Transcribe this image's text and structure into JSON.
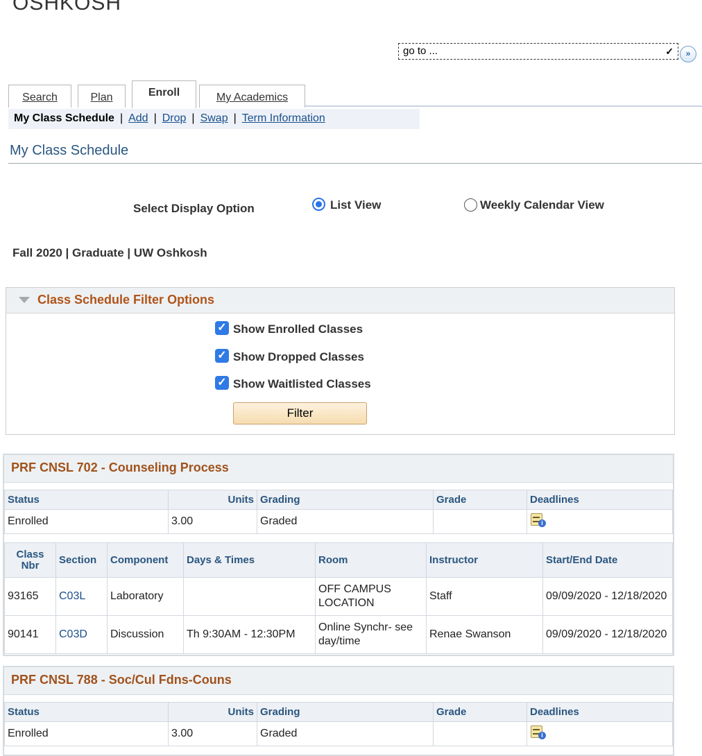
{
  "brand": {
    "logo_text": "OSHKOSH"
  },
  "goto": {
    "value": "go to ..."
  },
  "tabs": [
    {
      "label": "Search"
    },
    {
      "label": "Plan"
    },
    {
      "label": "Enroll"
    },
    {
      "label": "My Academics"
    }
  ],
  "subnav": {
    "current": "My Class Schedule",
    "links": [
      "Add",
      "Drop",
      "Swap",
      "Term Information"
    ]
  },
  "page_title": "My Class Schedule",
  "display_option": {
    "label": "Select Display Option",
    "list_view": "List View",
    "weekly_view": "Weekly Calendar View",
    "selected": "List View"
  },
  "term_info": "Fall 2020 | Graduate | UW Oshkosh",
  "filter": {
    "title": "Class Schedule Filter Options",
    "options": [
      {
        "label": "Show Enrolled Classes",
        "checked": true
      },
      {
        "label": "Show Dropped Classes",
        "checked": true
      },
      {
        "label": "Show Waitlisted Classes",
        "checked": true
      }
    ],
    "button": "Filter"
  },
  "status_headers": {
    "status": "Status",
    "units": "Units",
    "grading": "Grading",
    "grade": "Grade",
    "deadlines": "Deadlines"
  },
  "section_headers": {
    "class_nbr": "Class Nbr",
    "section": "Section",
    "component": "Component",
    "days_times": "Days & Times",
    "room": "Room",
    "instructor": "Instructor",
    "dates": "Start/End Date"
  },
  "classes": [
    {
      "title": "PRF CNSL 702 - Counseling Process",
      "status": "Enrolled",
      "units": "3.00",
      "grading": "Graded",
      "grade": "",
      "sections": [
        {
          "class_nbr": "93165",
          "section": "C03L",
          "component": "Laboratory",
          "days_times": "",
          "room": "OFF CAMPUS LOCATION",
          "instructor": "Staff",
          "dates": "09/09/2020 - 12/18/2020"
        },
        {
          "class_nbr": "90141",
          "section": "C03D",
          "component": "Discussion",
          "days_times": "Th 9:30AM - 12:30PM",
          "room": "Online Synchr- see day/time",
          "instructor": "Renae Swanson",
          "dates": "09/09/2020 - 12/18/2020"
        }
      ]
    },
    {
      "title": "PRF CNSL 788 - Soc/Cul Fdns-Couns",
      "status": "Enrolled",
      "units": "3.00",
      "grading": "Graded",
      "grade": ""
    }
  ]
}
